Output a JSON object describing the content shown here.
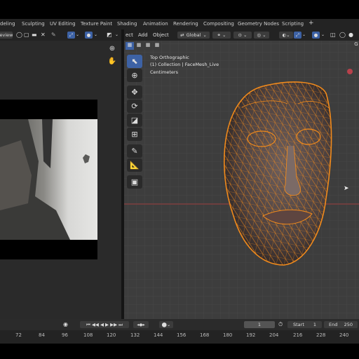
{
  "workspaces": [
    "deling",
    "Sculpting",
    "UV Editing",
    "Texture Paint",
    "Shading",
    "Animation",
    "Rendering",
    "Compositing",
    "Geometry Nodes",
    "Scripting",
    "+"
  ],
  "left_header": {
    "tab_label": "eview"
  },
  "viewport_header": {
    "menu": [
      "ect",
      "Add",
      "Object"
    ],
    "transform_orientation": "Global",
    "right_tab": "G"
  },
  "viewport_overlay": {
    "view": "Top Orthographic",
    "collection": "(1) Collection | FaceMesh_Live",
    "units": "Centimeters"
  },
  "timeline": {
    "current_frame": "1",
    "start_label": "Start",
    "start_value": "1",
    "end_label": "End",
    "end_value": "250"
  },
  "ruler": [
    "72",
    "84",
    "96",
    "108",
    "120",
    "132",
    "144",
    "156",
    "168",
    "180",
    "192",
    "204",
    "216",
    "228",
    "240"
  ],
  "colors": {
    "selection_orange": "#f08a1c",
    "accent_blue": "#3d62a5",
    "axis_red": "#9a3a3a"
  },
  "tools": [
    "select-box-icon",
    "cursor-icon",
    "move-icon",
    "rotate-icon",
    "scale-icon",
    "transform-icon",
    "annotate-icon",
    "measure-icon",
    "add-cube-icon"
  ]
}
